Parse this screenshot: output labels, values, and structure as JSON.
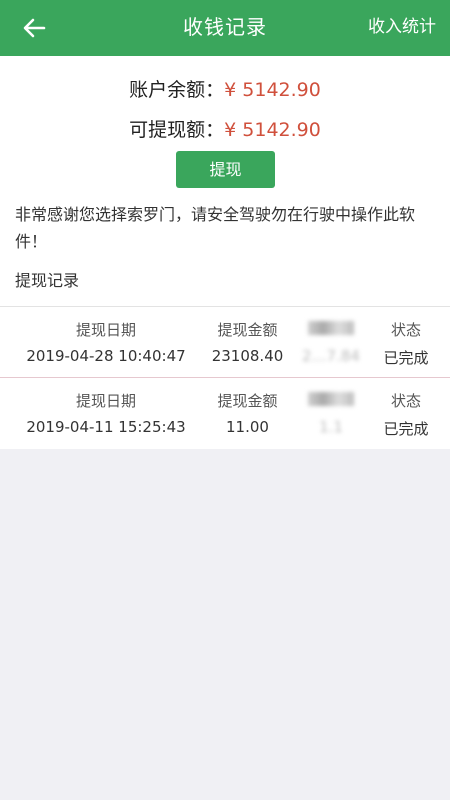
{
  "header": {
    "title": "收钱记录",
    "right_action": "收入统计"
  },
  "balance": {
    "account_label": "账户余额：",
    "account_value": "¥ 5142.90",
    "withdrawable_label": "可提现额：",
    "withdrawable_value": "¥ 5142.90"
  },
  "withdraw_button": "提现",
  "notice": "非常感谢您选择索罗门，请安全驾驶勿在行驶中操作此软件！",
  "records_title": "提现记录",
  "records": [
    {
      "h_date": "提现日期",
      "h_amount": "提现金额",
      "h_blur": "",
      "h_status": "状态",
      "date": "2019-04-28 10:40:47",
      "amount": "23108.40",
      "blur_value": "2…7.84",
      "status": "已完成"
    },
    {
      "h_date": "提现日期",
      "h_amount": "提现金额",
      "h_blur": "",
      "h_status": "状态",
      "date": "2019-04-11 15:25:43",
      "amount": "11.00",
      "blur_value": "1.1",
      "status": "已完成"
    }
  ],
  "colors": {
    "primary": "#3aa65c",
    "money": "#d0503c",
    "background": "#f0f0f4"
  },
  "icons": {
    "back": "arrow-left-icon"
  }
}
